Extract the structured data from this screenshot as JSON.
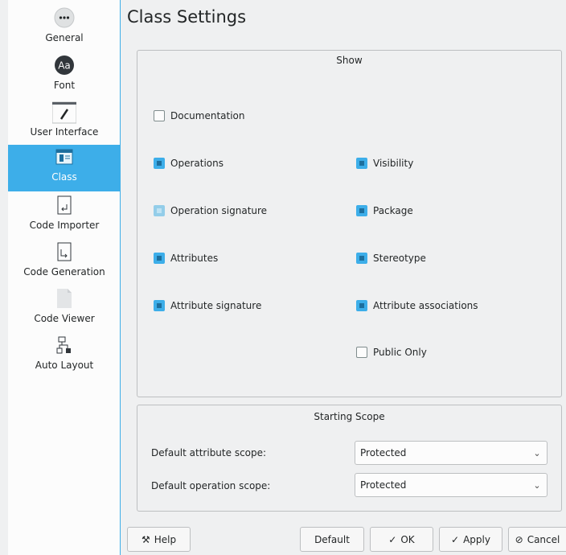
{
  "title": "Class Settings",
  "sidebar": {
    "items": [
      {
        "label": "General",
        "icon": "ellipsis-icon"
      },
      {
        "label": "Font",
        "icon": "font-icon"
      },
      {
        "label": "User Interface",
        "icon": "brush-window-icon"
      },
      {
        "label": "Class",
        "icon": "class-icon"
      },
      {
        "label": "Code Importer",
        "icon": "import-icon"
      },
      {
        "label": "Code Generation",
        "icon": "export-icon"
      },
      {
        "label": "Code Viewer",
        "icon": "document-icon"
      },
      {
        "label": "Auto Layout",
        "icon": "layout-icon"
      }
    ],
    "active_index": 3
  },
  "show_group": {
    "title": "Show",
    "documentation": "Documentation",
    "operations": "Operations",
    "operation_signature": "Operation signature",
    "attributes": "Attributes",
    "attribute_signature": "Attribute signature",
    "visibility": "Visibility",
    "package": "Package",
    "stereotype": "Stereotype",
    "attribute_associations": "Attribute associations",
    "public_only": "Public Only"
  },
  "scope_group": {
    "title": "Starting Scope",
    "attr_label": "Default attribute scope:",
    "attr_value": "Protected",
    "op_label": "Default operation scope:",
    "op_value": "Protected"
  },
  "buttons": {
    "help": "Help",
    "default": "Default",
    "ok": "OK",
    "apply": "Apply",
    "cancel": "Cancel"
  },
  "colors": {
    "accent": "#3daee9",
    "background": "#eff0f1"
  }
}
